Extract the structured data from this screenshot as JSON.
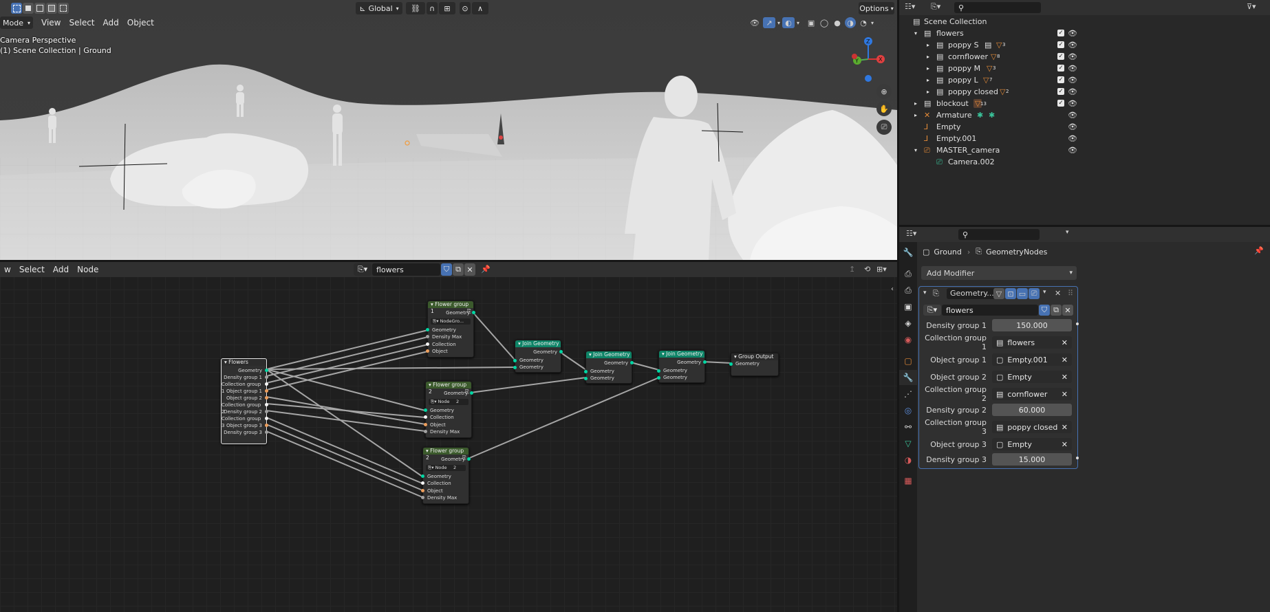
{
  "viewport": {
    "top_mode": "Mode",
    "menus": [
      "View",
      "Select",
      "Add",
      "Object"
    ],
    "transform_orientation": "Global",
    "options_label": "Options",
    "info_line1": "Camera Perspective",
    "info_line2": "(1) Scene Collection | Ground",
    "gizmo": {
      "z": "Z",
      "y": "Y",
      "x": "X"
    }
  },
  "node_editor": {
    "menus": [
      "w",
      "Select",
      "Add",
      "Node"
    ],
    "node_tree_name": "flowers",
    "nodes": {
      "flowers_input": {
        "title": "Flowers",
        "outputs": [
          "Geometry",
          "Density group 1",
          "Collection group 1",
          "Object group 1",
          "Object group 2",
          "Collection group 2",
          "Density group 2",
          "Collection group 3",
          "Object group 3",
          "Density group 3"
        ]
      },
      "flower_group_1": {
        "title": "Flower group 1",
        "output": "Geometry",
        "tree_label": "NodeGro...",
        "inputs": [
          "Geometry",
          "Density Max",
          "Collection",
          "Object"
        ]
      },
      "flower_group_2a": {
        "title": "Flower group 2",
        "output": "Geometry",
        "tree_label": "Node",
        "users": "2",
        "inputs": [
          "Geometry",
          "Collection",
          "Object",
          "Density Max"
        ]
      },
      "flower_group_2b": {
        "title": "Flower group 2",
        "output": "Geometry",
        "tree_label": "Node",
        "users": "2",
        "inputs": [
          "Geometry",
          "Collection",
          "Object",
          "Density Max"
        ]
      },
      "join_1": {
        "title": "Join Geometry",
        "output": "Geometry",
        "inputs": [
          "Geometry",
          "Geometry"
        ]
      },
      "join_2": {
        "title": "Join Geometry",
        "output": "Geometry",
        "inputs": [
          "Geometry",
          "Geometry"
        ]
      },
      "join_3": {
        "title": "Join Geometry",
        "output": "Geometry",
        "inputs": [
          "Geometry",
          "Geometry"
        ]
      },
      "group_output": {
        "title": "Group Output",
        "input": "Geometry"
      }
    }
  },
  "outliner": {
    "rows": [
      {
        "label": "Scene Collection",
        "indent": 0
      },
      {
        "label": "flowers",
        "indent": 1,
        "count": ""
      },
      {
        "label": "poppy S",
        "indent": 2,
        "count": "3"
      },
      {
        "label": "cornflower",
        "indent": 2,
        "count": "8"
      },
      {
        "label": "poppy M",
        "indent": 2,
        "count": "3"
      },
      {
        "label": "poppy L",
        "indent": 2,
        "count": "7"
      },
      {
        "label": "poppy closed",
        "indent": 2,
        "count": "2"
      },
      {
        "label": "blockout",
        "indent": 1,
        "count": "13"
      },
      {
        "label": "Armature",
        "indent": 1,
        "count": ""
      },
      {
        "label": "Empty",
        "indent": 1,
        "count": ""
      },
      {
        "label": "Empty.001",
        "indent": 1,
        "count": ""
      },
      {
        "label": "MASTER_camera",
        "indent": 1,
        "count": ""
      },
      {
        "label": "Camera.002",
        "indent": 2,
        "count": ""
      }
    ]
  },
  "properties": {
    "breadcrumb_object": "Ground",
    "breadcrumb_modifier": "GeometryNodes",
    "add_modifier_label": "Add Modifier",
    "modifier_name": "Geometry...",
    "node_group": "flowers",
    "fields": [
      {
        "label": "Density group 1",
        "value": "150.000",
        "kind": "num"
      },
      {
        "label": "Collection group 1",
        "value": "flowers",
        "kind": "coll"
      },
      {
        "label": "Object group 1",
        "value": "Empty.001",
        "kind": "obj"
      },
      {
        "label": "Object group 2",
        "value": "Empty",
        "kind": "obj"
      },
      {
        "label": "Collection group 2",
        "value": "cornflower",
        "kind": "coll"
      },
      {
        "label": "Density group 2",
        "value": "60.000",
        "kind": "num"
      },
      {
        "label": "Collection group 3",
        "value": "poppy closed",
        "kind": "coll"
      },
      {
        "label": "Object group 3",
        "value": "Empty",
        "kind": "obj"
      },
      {
        "label": "Density group 3",
        "value": "15.000",
        "kind": "num"
      }
    ]
  },
  "colors": {
    "accent_blue": "#4772b3",
    "geometry_socket": "#00d6a3",
    "node_header_group": "#3b5a2c",
    "node_header_join": "#0e8467",
    "collection_socket": "#f5f5f5",
    "object_socket": "#ed9e5c",
    "float_socket": "#a1a1a1"
  }
}
